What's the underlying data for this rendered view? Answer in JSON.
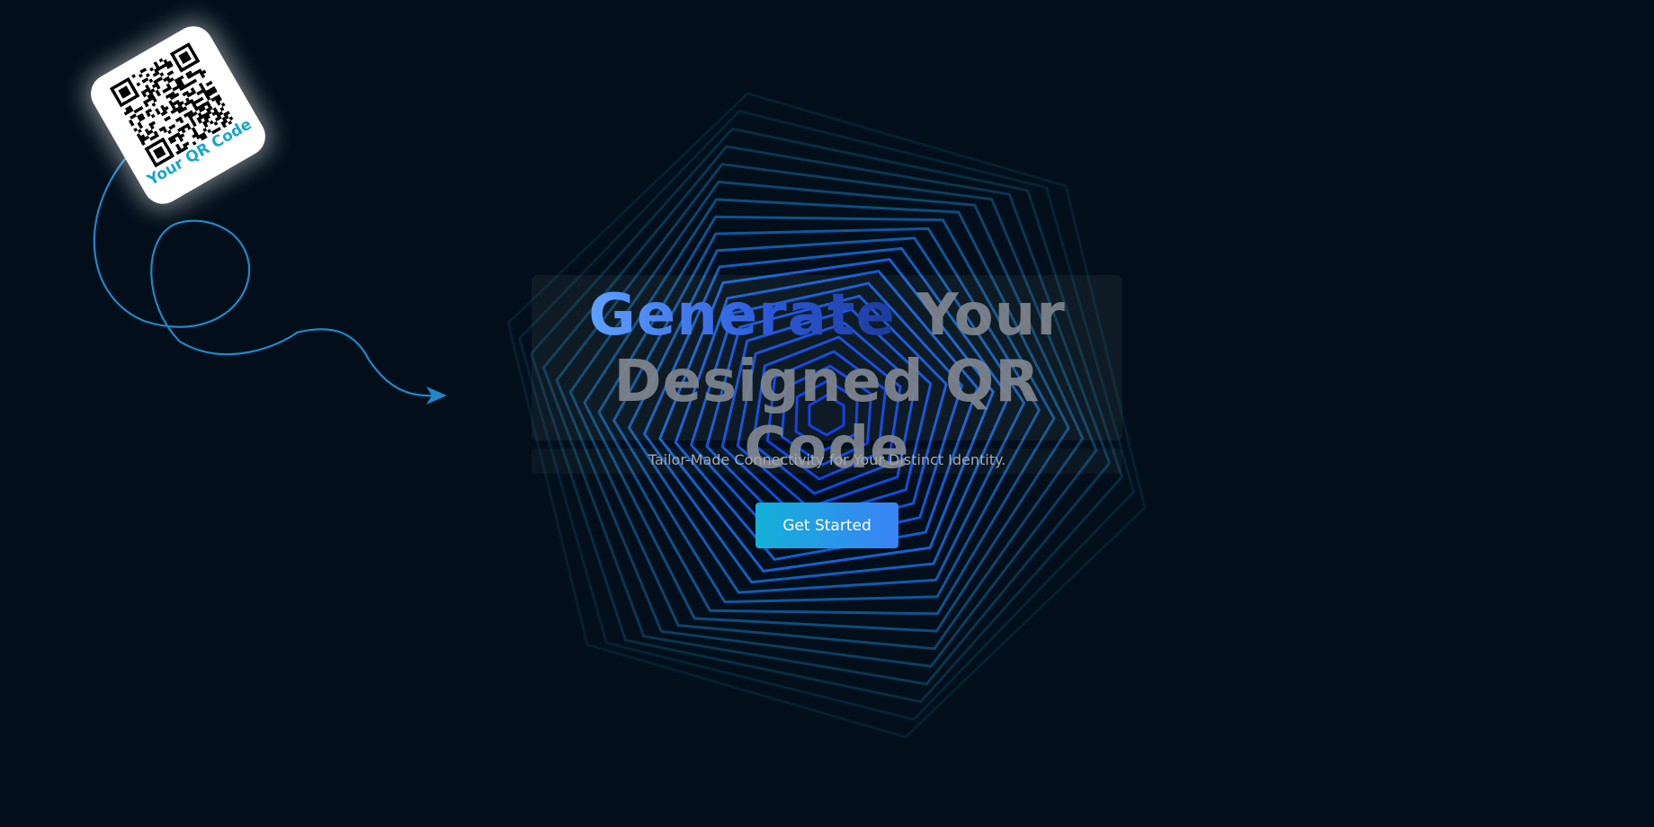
{
  "hero": {
    "title_highlight": "Generate",
    "title_rest_line1": "Your",
    "title_line2": "Designed QR Code",
    "subtitle": "Tailor-Made Connectivity for Your Distinct Identity.",
    "cta_label": "Get Started"
  },
  "qr_card": {
    "caption": "Your QR Code"
  },
  "colors": {
    "background": "#020f1a",
    "accent": "#19a6c9",
    "title_gradient_start": "#5ea2ff",
    "title_gradient_end": "#1d3a9c",
    "button_gradient_start": "#13b1d8",
    "button_gradient_end": "#3b82f6",
    "ring_inner": "#0a3bff",
    "ring_outer": "#1fa0c8"
  },
  "icons": {
    "qr": "qr-code-icon",
    "arrow": "curly-arrow-icon",
    "background": "hexagon-rings-decoration"
  }
}
